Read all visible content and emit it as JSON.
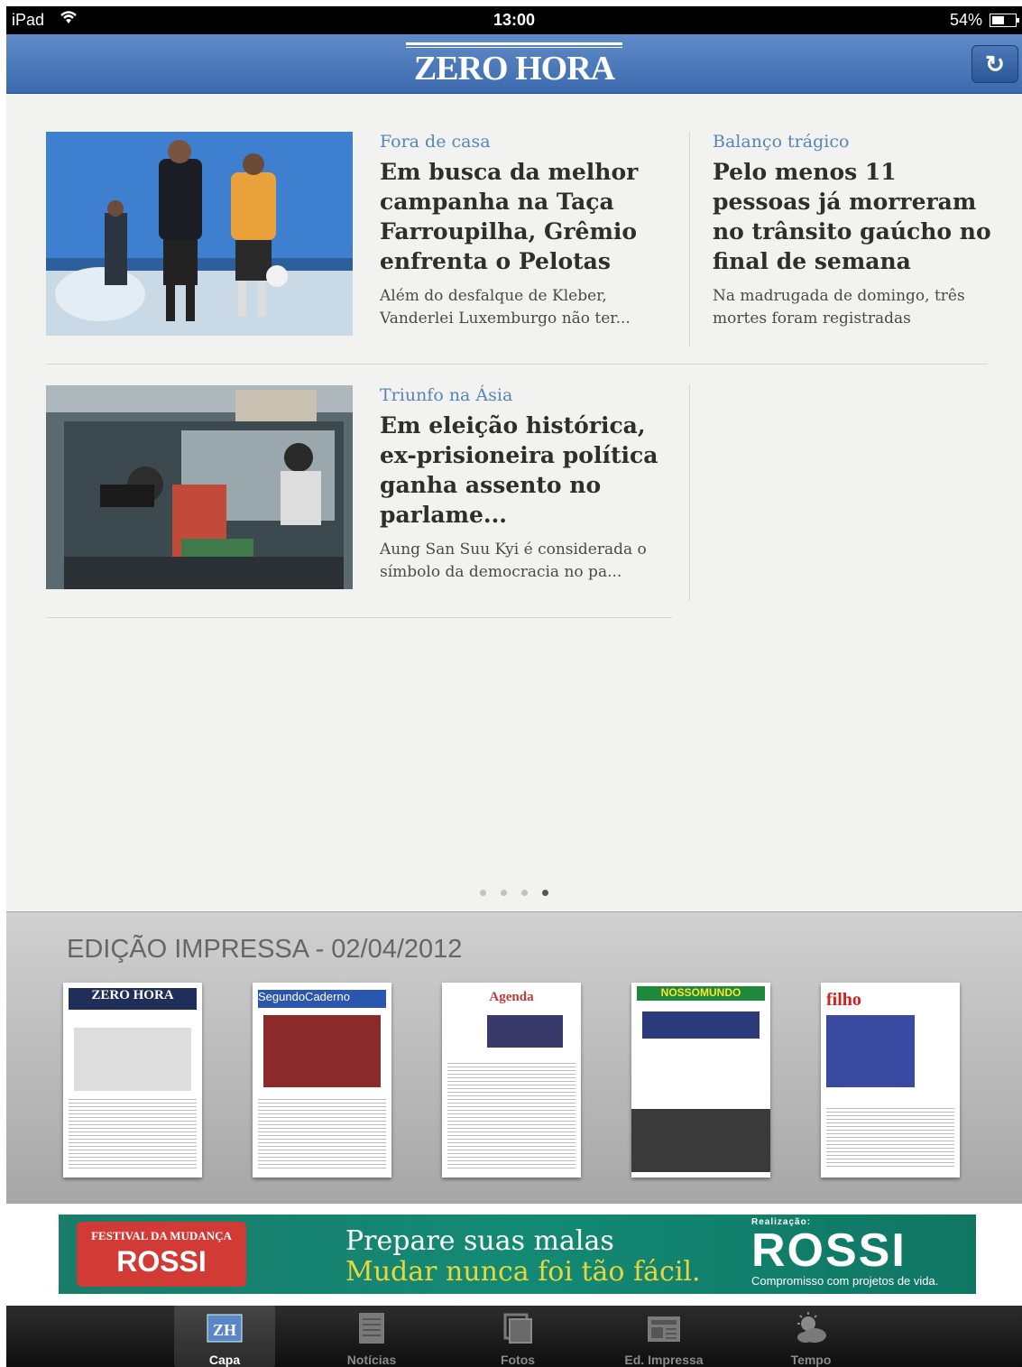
{
  "status_bar": {
    "carrier": "iPad",
    "time": "13:00",
    "battery": "54%"
  },
  "navbar": {
    "logo": "ZERO HORA"
  },
  "stories": [
    {
      "kicker": "Fora de casa",
      "headline": "Em busca da melhor campanha na Taça Farroupilha, Grêmio enfrenta o Pelotas",
      "summary": "Além do desfalque de Kleber, Vanderlei Luxemburgo não ter..."
    },
    {
      "kicker": "Balanço trágico",
      "headline": "Pelo menos 11 pessoas já morreram no trânsito gaúcho no final de semana",
      "summary": "Na madrugada de domingo, três mortes foram registradas"
    },
    {
      "kicker": "Triunfo na Ásia",
      "headline": "Em eleição histórica, ex-prisioneira política ganha assento no parlame...",
      "summary": "Aung San Suu Kyi é considerada o símbolo da democracia no pa..."
    }
  ],
  "pager": {
    "count": 4,
    "active_index": 3
  },
  "print_edition": {
    "title": "EDIÇÃO IMPRESSA - 02/04/2012",
    "pages": [
      {
        "label": "ZERO HORA"
      },
      {
        "label": "SegundoCaderno"
      },
      {
        "label": "Agenda"
      },
      {
        "label": "NOSSOMUNDO"
      },
      {
        "label": "filho"
      }
    ]
  },
  "ad": {
    "badge_top": "FESTIVAL DA MUDANÇA",
    "badge_brand": "ROSSI",
    "line1": "Prepare suas malas",
    "line2": "Mudar nunca foi tão fácil.",
    "realizacao": "Realização:",
    "brand": "ROSSI",
    "slogan": "Compromisso com projetos de vida."
  },
  "tabs": [
    {
      "label": "Capa",
      "icon": "zh-logo-icon"
    },
    {
      "label": "Notícias",
      "icon": "news-icon"
    },
    {
      "label": "Fotos",
      "icon": "photos-icon"
    },
    {
      "label": "Ed. Impressa",
      "icon": "newspaper-icon"
    },
    {
      "label": "Tempo",
      "icon": "weather-icon"
    }
  ],
  "colors": {
    "navbar": "#4a77b9",
    "kicker": "#5785b8",
    "ad_bg": "#138a74"
  }
}
